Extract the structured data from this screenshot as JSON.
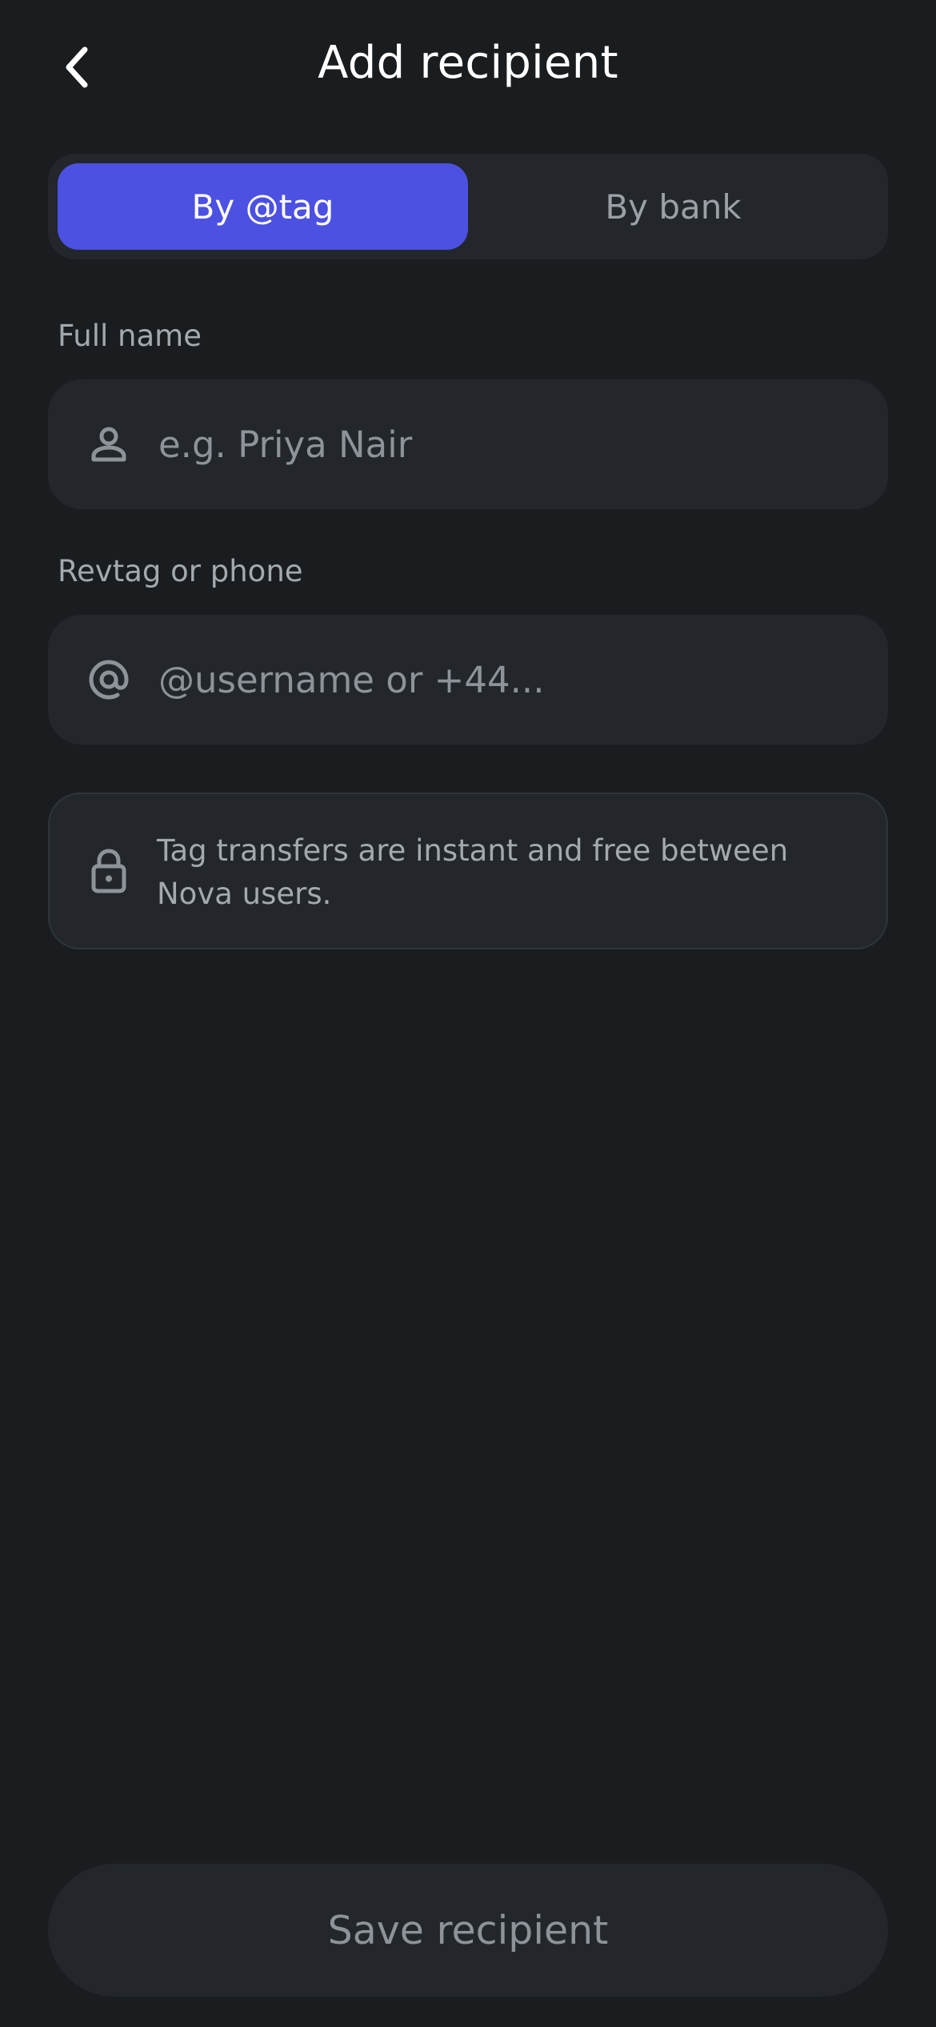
{
  "header": {
    "title": "Add recipient",
    "back_icon": "chevron-left-icon"
  },
  "tabs": [
    {
      "label": "By @tag",
      "active": true
    },
    {
      "label": "By bank",
      "active": false
    }
  ],
  "form": {
    "full_name": {
      "label": "Full name",
      "placeholder": "e.g. Priya Nair",
      "value": "",
      "icon": "person-icon"
    },
    "revtag": {
      "label": "Revtag or phone",
      "placeholder": "@username or +44...",
      "value": "",
      "icon": "at-sign-icon"
    }
  },
  "info": {
    "icon": "lock-icon",
    "text": "Tag transfers are instant and free between Nova users."
  },
  "save_button": {
    "label": "Save recipient",
    "enabled": false
  },
  "colors": {
    "background": "#1a1d20",
    "surface": "#23272b",
    "accent": "#4c51e2",
    "muted_text": "#a4a9ae",
    "placeholder_text": "#8d9399"
  }
}
